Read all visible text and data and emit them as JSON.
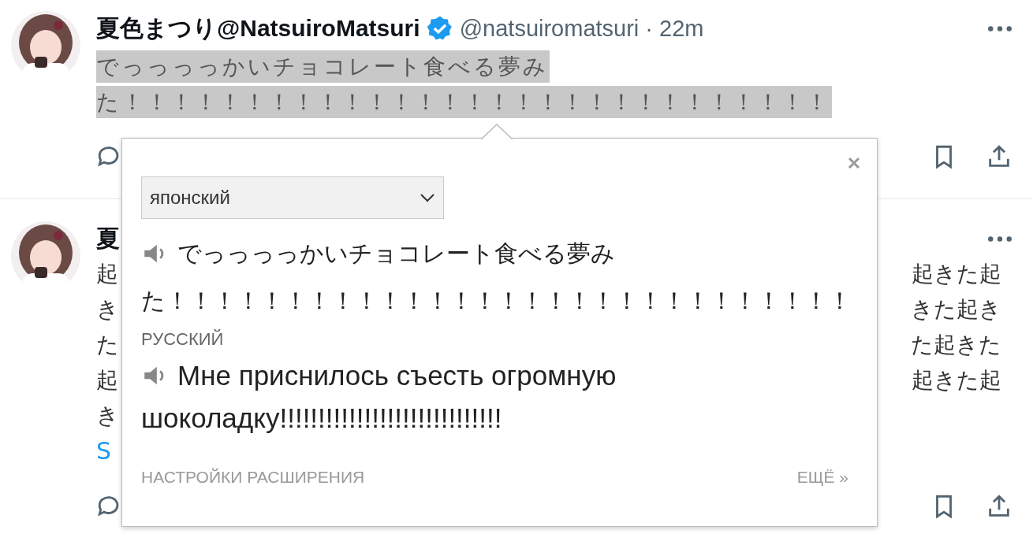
{
  "tweet": {
    "author": "夏色まつり@NatsuiroMatsuri",
    "verified": true,
    "meta": "@natsuiromatsuri · 22m",
    "highlighted": true,
    "text_lines": [
      "でっっっっかいチョコレート食べる夢み",
      "た！！！！！！！！！！！！！！！！！！！！！！！！！！！！！"
    ]
  },
  "second_tweet": {
    "author": "夏",
    "show_more": "S",
    "body_lines": [
      {
        "left": "起",
        "right": "起きた起"
      },
      {
        "left": "き",
        "right": "きた起き"
      },
      {
        "left": "た",
        "right": "た起きた"
      },
      {
        "left": "起",
        "right": "起きた起"
      },
      {
        "left": "き"
      }
    ]
  },
  "popup": {
    "source_language": "японский",
    "source_lines": [
      "でっっっっかいチョコレート食べる夢み",
      "た！！！！！！！！！！！！！！！！！！！！！！！！！！！！！"
    ],
    "target_language": "РУССКИЙ",
    "target_lines": [
      "Мне приснилось съесть огромную",
      "шоколадку!!!!!!!!!!!!!!!!!!!!!!!!!!!!!"
    ],
    "settings_link": "НАСТРОЙКИ РАСШИРЕНИЯ",
    "more_link": "ЕЩЁ »"
  }
}
